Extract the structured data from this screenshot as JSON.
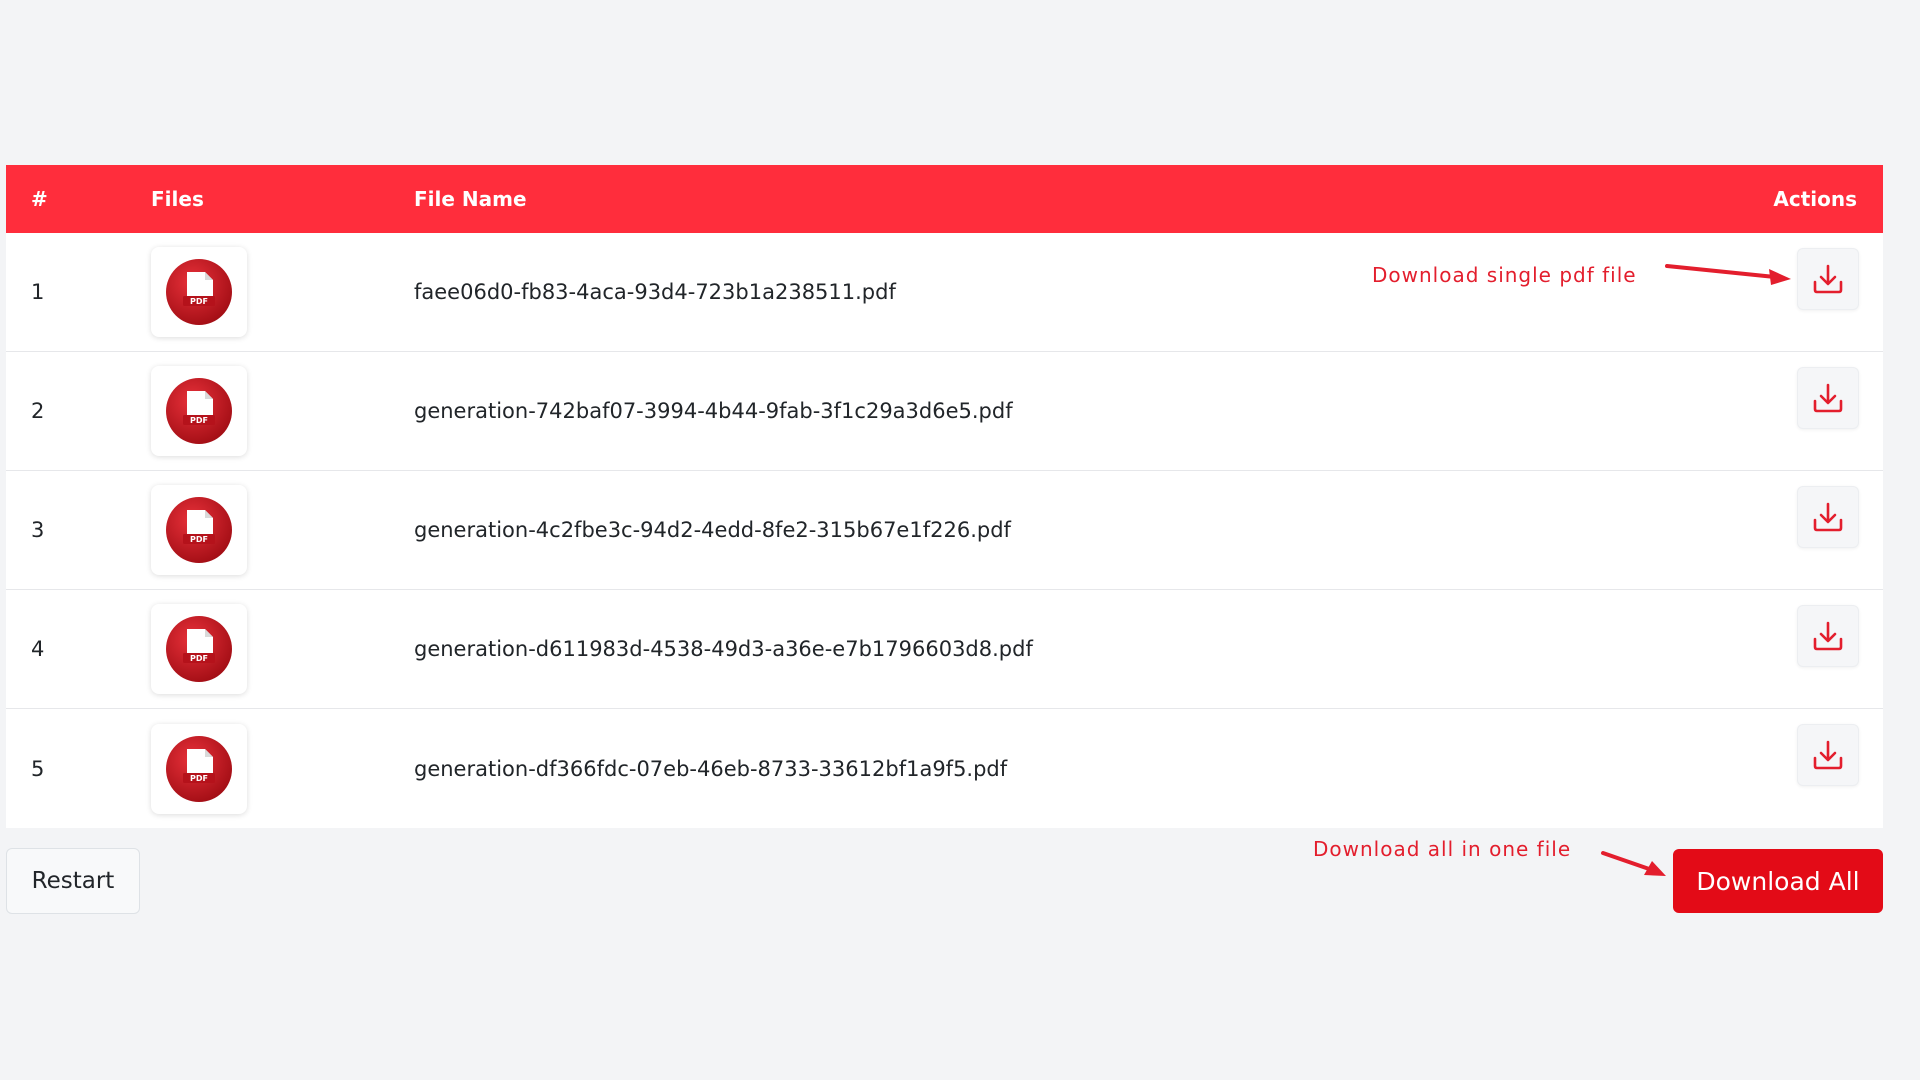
{
  "table": {
    "headers": {
      "num": "#",
      "files": "Files",
      "file_name": "File Name",
      "actions": "Actions"
    },
    "rows": [
      {
        "num": "1",
        "file_name": "faee06d0-fb83-4aca-93d4-723b1a238511.pdf",
        "icon": "pdf-file-icon",
        "action_icon": "download-icon"
      },
      {
        "num": "2",
        "file_name": "generation-742baf07-3994-4b44-9fab-3f1c29a3d6e5.pdf",
        "icon": "pdf-file-icon",
        "action_icon": "download-icon"
      },
      {
        "num": "3",
        "file_name": "generation-4c2fbe3c-94d2-4edd-8fe2-315b67e1f226.pdf",
        "icon": "pdf-file-icon",
        "action_icon": "download-icon"
      },
      {
        "num": "4",
        "file_name": "generation-d611983d-4538-49d3-a36e-e7b1796603d8.pdf",
        "icon": "pdf-file-icon",
        "action_icon": "download-icon"
      },
      {
        "num": "5",
        "file_name": "generation-df366fdc-07eb-46eb-8733-33612bf1a9f5.pdf",
        "icon": "pdf-file-icon",
        "action_icon": "download-icon"
      }
    ]
  },
  "annotations": {
    "single": "Download single pdf file",
    "all": "Download all in one file"
  },
  "footer": {
    "restart_label": "Restart",
    "download_all_label": "Download All"
  },
  "pdf_badge": "PDF",
  "colors": {
    "header_bg": "#ff2d3c",
    "accent": "#e30b17",
    "annotation": "#e31e2d"
  }
}
